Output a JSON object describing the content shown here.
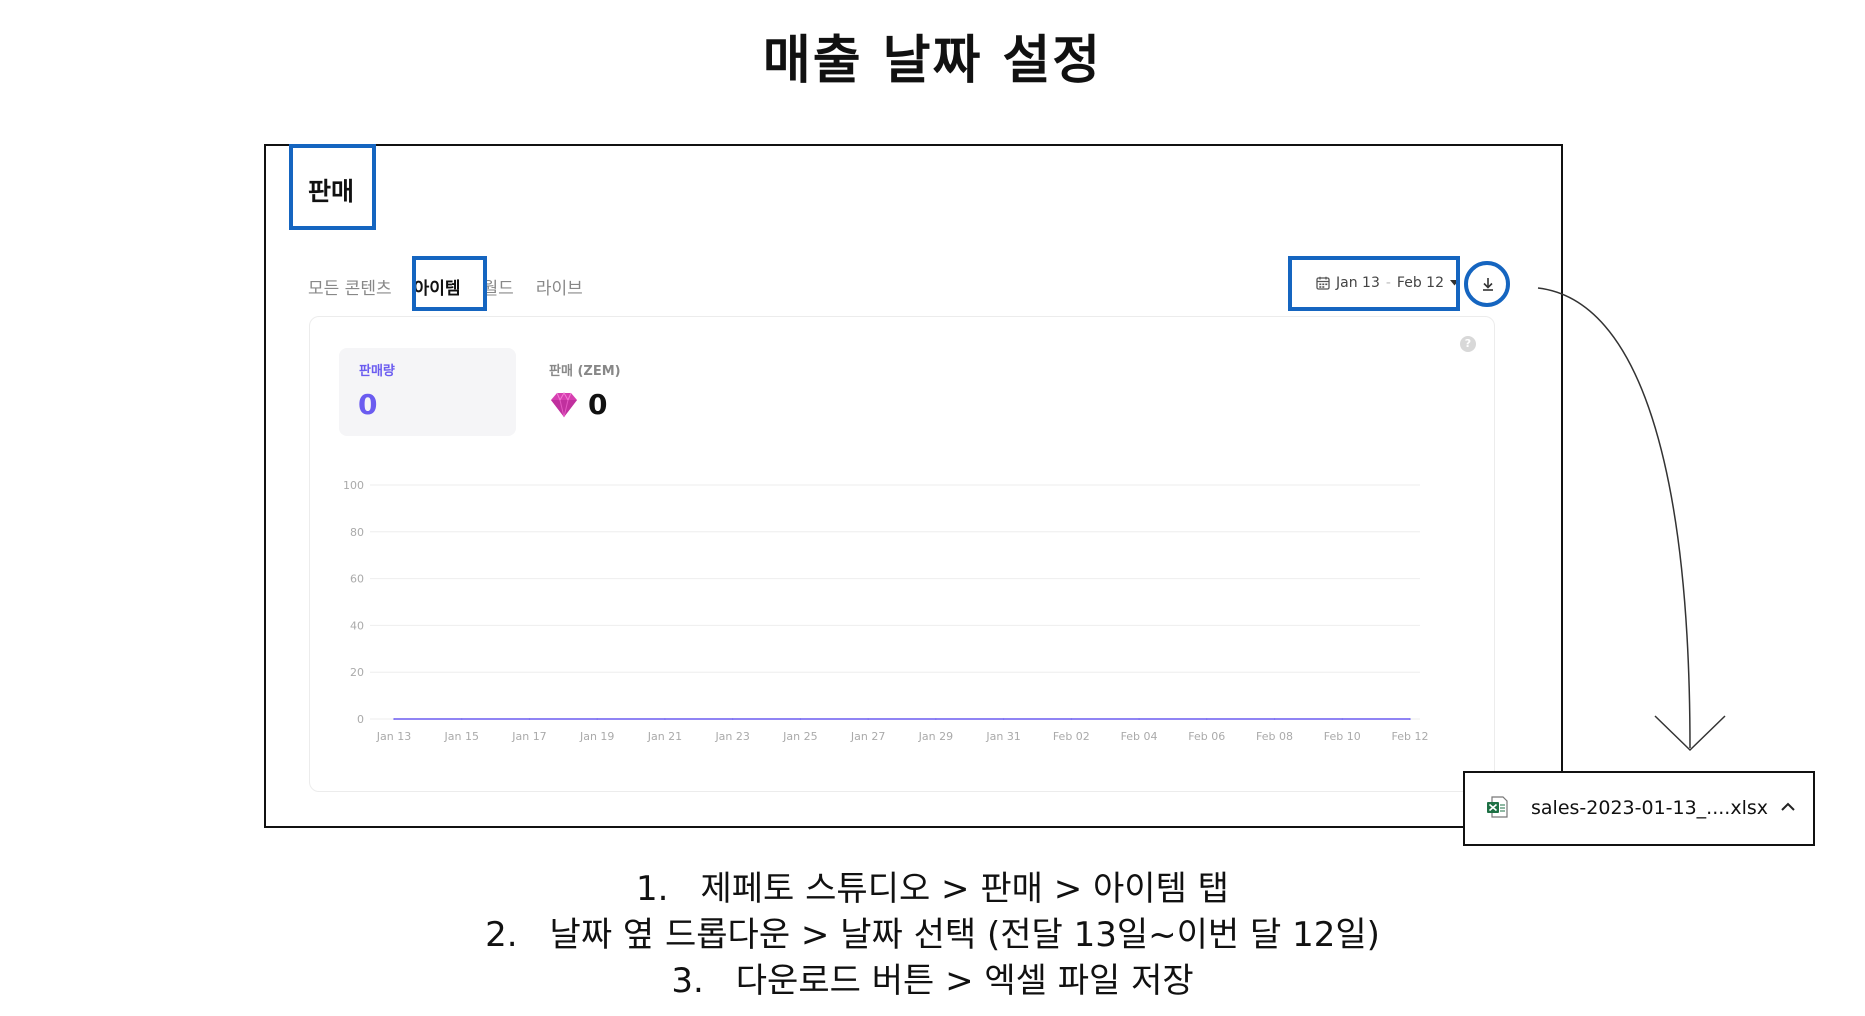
{
  "slide": {
    "title": "매출 날짜 설정"
  },
  "page": {
    "title": "판매",
    "tabs": [
      {
        "label": "모든 콘텐츠",
        "active": false
      },
      {
        "label": "아이템",
        "active": true
      },
      {
        "label": "월드",
        "active": false
      },
      {
        "label": "라이브",
        "active": false
      }
    ],
    "date_range": {
      "start": "Jan 13",
      "separator": "-",
      "end": "Feb 12"
    },
    "help_glyph": "?"
  },
  "metrics": {
    "sales_count": {
      "label": "판매량",
      "value": "0"
    },
    "sales_zem": {
      "label": "판매 (ZEM)",
      "value": "0"
    }
  },
  "chart_data": {
    "type": "line",
    "x": [
      "Jan 13",
      "Jan 15",
      "Jan 17",
      "Jan 19",
      "Jan 21",
      "Jan 23",
      "Jan 25",
      "Jan 27",
      "Jan 29",
      "Jan 31",
      "Feb 02",
      "Feb 04",
      "Feb 06",
      "Feb 08",
      "Feb 10",
      "Feb 12"
    ],
    "series": [
      {
        "values": [
          0,
          0,
          0,
          0,
          0,
          0,
          0,
          0,
          0,
          0,
          0,
          0,
          0,
          0,
          0,
          0
        ]
      }
    ],
    "yticks": [
      0,
      20,
      40,
      60,
      80,
      100
    ],
    "ylim": [
      0,
      100
    ],
    "grid": true,
    "line_color": "#6b5cf0"
  },
  "download_popup": {
    "filename": "sales-2023-01-13_....xlsx"
  },
  "steps": [
    {
      "num": "1.",
      "text": "제페토 스튜디오 > 판매 > 아이템 탭"
    },
    {
      "num": "2.",
      "text": "날짜 옆 드롭다운 > 날짜 선택 (전달 13일~이번 달 12일)"
    },
    {
      "num": "3.",
      "text": "다운로드 버튼 > 엑셀 파일 저장"
    }
  ],
  "colors": {
    "highlight": "#1565c0",
    "accent": "#6b5cf0",
    "gem": "#d63fb0"
  }
}
